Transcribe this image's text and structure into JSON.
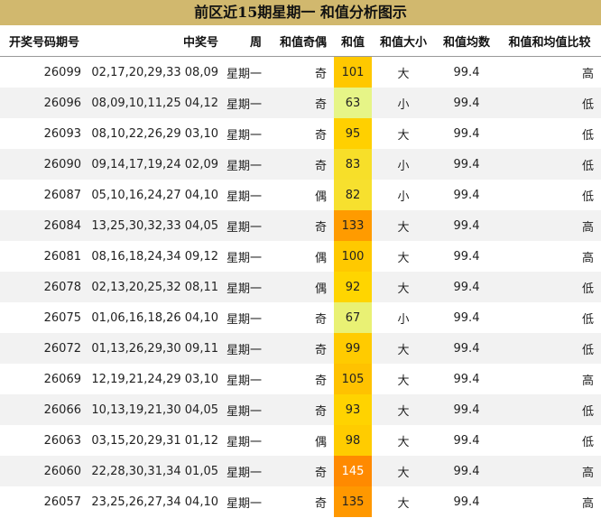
{
  "title": "前区近15期星期一 和值分析图示",
  "columns": [
    "开奖号码期号",
    "中奖号",
    "周",
    "和值奇偶",
    "和值",
    "和值大小",
    "和值均数",
    "和值和均值比较"
  ],
  "colors": {
    "title_bg": "#d1b86e",
    "avg_bg": "#dcf27a",
    "heat_low": "#e6f587",
    "heat_mid": "#ffd500",
    "heat_high": "#ff8a00"
  },
  "rows": [
    {
      "issue": "26099",
      "numbers": "02,17,20,29,33 08,09",
      "week": "星期一",
      "parity": "奇",
      "sum": "101",
      "size": "大",
      "avg": "99.4",
      "cmp": "高"
    },
    {
      "issue": "26096",
      "numbers": "08,09,10,11,25 04,12",
      "week": "星期一",
      "parity": "奇",
      "sum": "63",
      "size": "小",
      "avg": "99.4",
      "cmp": "低"
    },
    {
      "issue": "26093",
      "numbers": "08,10,22,26,29 03,10",
      "week": "星期一",
      "parity": "奇",
      "sum": "95",
      "size": "大",
      "avg": "99.4",
      "cmp": "低"
    },
    {
      "issue": "26090",
      "numbers": "09,14,17,19,24 02,09",
      "week": "星期一",
      "parity": "奇",
      "sum": "83",
      "size": "小",
      "avg": "99.4",
      "cmp": "低"
    },
    {
      "issue": "26087",
      "numbers": "05,10,16,24,27 04,10",
      "week": "星期一",
      "parity": "偶",
      "sum": "82",
      "size": "小",
      "avg": "99.4",
      "cmp": "低"
    },
    {
      "issue": "26084",
      "numbers": "13,25,30,32,33 04,05",
      "week": "星期一",
      "parity": "奇",
      "sum": "133",
      "size": "大",
      "avg": "99.4",
      "cmp": "高"
    },
    {
      "issue": "26081",
      "numbers": "08,16,18,24,34 09,12",
      "week": "星期一",
      "parity": "偶",
      "sum": "100",
      "size": "大",
      "avg": "99.4",
      "cmp": "高"
    },
    {
      "issue": "26078",
      "numbers": "02,13,20,25,32 08,11",
      "week": "星期一",
      "parity": "偶",
      "sum": "92",
      "size": "大",
      "avg": "99.4",
      "cmp": "低"
    },
    {
      "issue": "26075",
      "numbers": "01,06,16,18,26 04,10",
      "week": "星期一",
      "parity": "奇",
      "sum": "67",
      "size": "小",
      "avg": "99.4",
      "cmp": "低"
    },
    {
      "issue": "26072",
      "numbers": "01,13,26,29,30 09,11",
      "week": "星期一",
      "parity": "奇",
      "sum": "99",
      "size": "大",
      "avg": "99.4",
      "cmp": "低"
    },
    {
      "issue": "26069",
      "numbers": "12,19,21,24,29 03,10",
      "week": "星期一",
      "parity": "奇",
      "sum": "105",
      "size": "大",
      "avg": "99.4",
      "cmp": "高"
    },
    {
      "issue": "26066",
      "numbers": "10,13,19,21,30 04,05",
      "week": "星期一",
      "parity": "奇",
      "sum": "93",
      "size": "大",
      "avg": "99.4",
      "cmp": "低"
    },
    {
      "issue": "26063",
      "numbers": "03,15,20,29,31 01,12",
      "week": "星期一",
      "parity": "偶",
      "sum": "98",
      "size": "大",
      "avg": "99.4",
      "cmp": "低"
    },
    {
      "issue": "26060",
      "numbers": "22,28,30,31,34 01,05",
      "week": "星期一",
      "parity": "奇",
      "sum": "145",
      "size": "大",
      "avg": "99.4",
      "cmp": "高"
    },
    {
      "issue": "26057",
      "numbers": "23,25,26,27,34 04,10",
      "week": "星期一",
      "parity": "奇",
      "sum": "135",
      "size": "大",
      "avg": "99.4",
      "cmp": "高"
    }
  ],
  "chart_data": {
    "type": "table",
    "title": "前区近15期星期一 和值分析图示",
    "columns": [
      "开奖号码期号",
      "中奖号",
      "周",
      "和值奇偶",
      "和值",
      "和值大小",
      "和值均数",
      "和值和均值比较"
    ],
    "x": [
      "26099",
      "26096",
      "26093",
      "26090",
      "26087",
      "26084",
      "26081",
      "26078",
      "26075",
      "26072",
      "26069",
      "26066",
      "26063",
      "26060",
      "26057"
    ],
    "series": [
      {
        "name": "和值",
        "values": [
          101,
          63,
          95,
          83,
          82,
          133,
          100,
          92,
          67,
          99,
          105,
          93,
          98,
          145,
          135
        ]
      },
      {
        "name": "和值均数",
        "values": [
          99.4,
          99.4,
          99.4,
          99.4,
          99.4,
          99.4,
          99.4,
          99.4,
          99.4,
          99.4,
          99.4,
          99.4,
          99.4,
          99.4,
          99.4
        ]
      }
    ]
  }
}
